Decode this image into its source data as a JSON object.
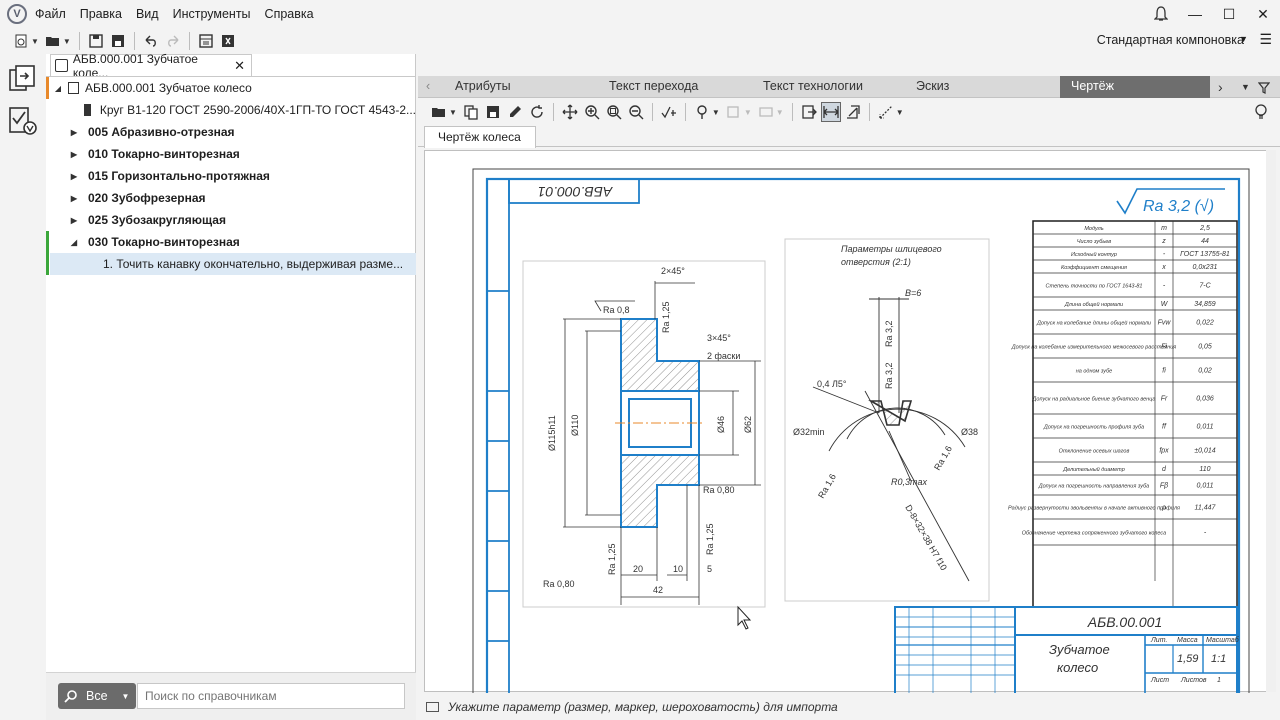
{
  "menu": {
    "items": [
      "Файл",
      "Правка",
      "Вид",
      "Инструменты",
      "Справка"
    ]
  },
  "toolbar": {
    "layout_label": "Стандартная компоновка"
  },
  "document_tab": {
    "title": "АБВ.000.001 Зубчатое коле..."
  },
  "tree": {
    "root": "АБВ.000.001 Зубчатое колесо",
    "material": "Круг В1-120 ГОСТ 2590-2006/40Х-1ГП-ТО ГОСТ 4543-2...",
    "operations": [
      "005 Абразивно-отрезная",
      "010 Токарно-винторезная",
      "015 Горизонтально-протяжная",
      "020 Зубофрезерная",
      "025 Зубозакругляющая",
      "030 Токарно-винторезная"
    ],
    "step": "1. Точить канавку окончательно, выдерживая разме..."
  },
  "search": {
    "button_label": "Все",
    "placeholder": "Поиск по справочникам"
  },
  "right_tabs": [
    "Атрибуты",
    "Текст перехода",
    "Текст технологии",
    "Эскиз",
    "Чертёж"
  ],
  "sub_tab": "Чертёж колеса",
  "status": "Укажите параметр (размер, маркер, шероховатость) для импорта",
  "colors": {
    "accent_orange": "#e8892b",
    "accent_green": "#3aa63a",
    "drawing_blue": "#1f7fc9",
    "selected_row": "#dce9f5"
  },
  "drawing": {
    "stamp_rotated": "АБВ.000.01",
    "roughness": "Ra 3,2 (√)",
    "title_code": "АБВ.00.001",
    "title_name_1": "Зубчатое",
    "title_name_2": "колесо",
    "mass": "1,59",
    "scale": "1:1",
    "sheet_hdr": "Лит.",
    "mass_hdr": "Масса",
    "scale_hdr": "Масштаб",
    "sheet": "Лист",
    "sheets": "Листов",
    "sheets_val": "1",
    "spline_title_1": "Параметры шлицевого",
    "spline_title_2": "отверстия (2:1)",
    "dims": {
      "chamfer1": "2×45°",
      "chamfer2": "3×45°",
      "facets": "2 фаски",
      "ra08a": "Ra 0,8",
      "ra125a": "Ra 1,25",
      "ra08b": "Ra 0,80",
      "ra125b": "Ra 1,25",
      "ra125c": "Ra 1,25",
      "ra08c": "Ra 0,80",
      "d115": "Ø115h11",
      "d110": "Ø110",
      "d46": "Ø46",
      "d62": "Ø62",
      "l20": "20",
      "l10": "10",
      "l5": "5",
      "l42": "42",
      "b6": "B=6",
      "ra32a": "Ra 3,2",
      "ra32b": "Ra 3,2",
      "a045": "0,4 Л5°",
      "d32": "Ø32min",
      "d38": "Ø38",
      "ra16a": "Ra 1,6",
      "ra16b": "Ra 1,6",
      "r03": "R0,3max",
      "spline": "D-8×32×38 H7 f10"
    },
    "table": [
      [
        "Модуль",
        "m",
        "2,5"
      ],
      [
        "Число зубьев",
        "z",
        "44"
      ],
      [
        "Исходный контур",
        "-",
        "ГОСТ 13755-81"
      ],
      [
        "Коэффициент смещения",
        "x",
        "0,0х231"
      ],
      [
        "Степень точности по ГОСТ 1643-81",
        "-",
        "7-С"
      ],
      [
        "Длина общей нормали",
        "W",
        "34,859"
      ],
      [
        "Допуск на колебание длины общей нормали",
        "Fvw",
        "0,022"
      ],
      [
        "Допуск на колебание измерительного межосевого расстояния",
        "Fi",
        "0,05"
      ],
      [
        "на одном зубе",
        "fi",
        "0,02"
      ],
      [
        "Допуск на радиальное биение зубчатого венца",
        "Fr",
        "0,036"
      ],
      [
        "Допуск на погрешность профиля зуба",
        "ff",
        "0,011"
      ],
      [
        "Отклонение осевых шагов",
        "fpx",
        "±0,014"
      ],
      [
        "Делительный диаметр",
        "d",
        "110"
      ],
      [
        "Допуск на погрешность направления зуба",
        "Fβ",
        "0,011"
      ],
      [
        "Радиус развернутости эвольвенты в начале активного профиля",
        "ρ",
        "11,447"
      ],
      [
        "Обозначение чертежа сопряженного зубчатого колеса",
        "",
        "-"
      ]
    ]
  }
}
